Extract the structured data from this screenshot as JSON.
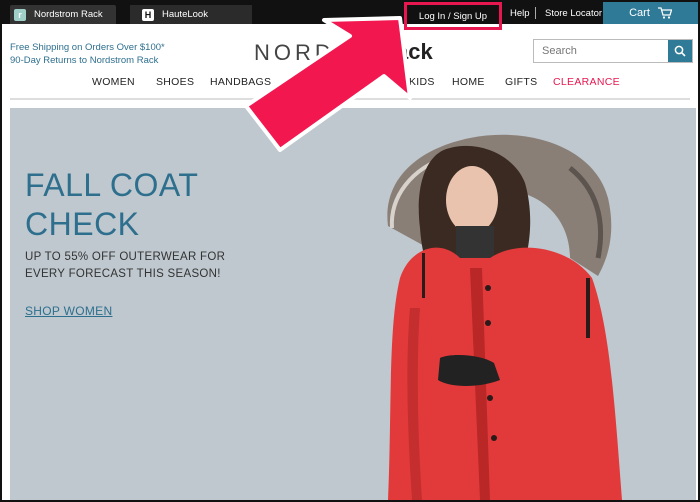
{
  "topbar": {
    "tabs": [
      {
        "icon_letter": "r",
        "label": "Nordstrom Rack"
      },
      {
        "icon_letter": "H",
        "label": "HauteLook"
      }
    ],
    "login_label": "Log In / Sign Up",
    "help_label": "Help",
    "store_locator_label": "Store Locator",
    "cart_label": "Cart"
  },
  "header": {
    "shipping_line1": "Free Shipping on Orders Over $100*",
    "shipping_line2": "90-Day Returns to Nordstrom Rack",
    "logo_left": "NORDS",
    "logo_right": "ack",
    "search_placeholder": "Search"
  },
  "nav": {
    "items": [
      "WOMEN",
      "SHOES",
      "HANDBAGS",
      "KIDS",
      "HOME",
      "GIFTS",
      "CLEARANCE"
    ]
  },
  "hero": {
    "title_line1": "FALL COAT",
    "title_line2": "CHECK",
    "sub_line1": "UP TO 55% OFF OUTERWEAR FOR",
    "sub_line2": "EVERY FORECAST THIS SEASON!",
    "cta": "SHOP WOMEN"
  },
  "colors": {
    "accent": "#2e7a97",
    "highlight": "#e8174f",
    "clearance": "#e8174f",
    "hero_bg": "#bfc8cf",
    "coat": "#e23a3a"
  },
  "icons": [
    "cart-icon",
    "search-icon",
    "nordstrom-rack-icon",
    "hautelook-icon",
    "pointer-arrow-icon"
  ]
}
